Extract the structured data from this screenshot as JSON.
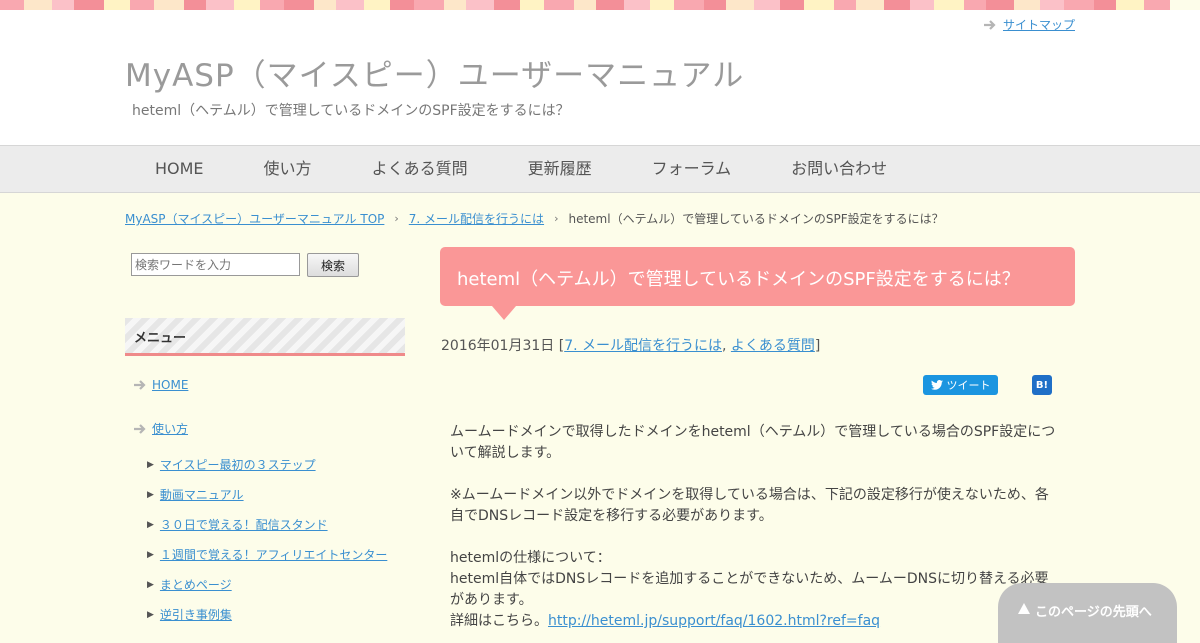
{
  "header": {
    "sitemap_label": "サイトマップ",
    "site_title": "MyASP（マイスピー）ユーザーマニュアル",
    "site_subtitle": "heteml（ヘテムル）で管理しているドメインのSPF設定をするには？"
  },
  "nav": [
    "HOME",
    "使い方",
    "よくある質問",
    "更新履歴",
    "フォーラム",
    "お問い合わせ"
  ],
  "breadcrumb": [
    "MyASP（マイスピー）ユーザーマニュアル TOP",
    "7. メール配信を行うには",
    "heteml（ヘテムル）で管理しているドメインのSPF設定をするには？"
  ],
  "search": {
    "placeholder": "検索ワードを入力",
    "button": "検索"
  },
  "sidebar": {
    "menu_heading": "メニュー",
    "items": [
      "HOME",
      "使い方"
    ],
    "sub_items": [
      "マイスピー最初の３ステップ",
      "動画マニュアル",
      "３０日で覚える！配信スタンド",
      "１週間で覚える！アフィリエイトセンター",
      "まとめページ",
      "逆引き事例集"
    ]
  },
  "post": {
    "title": "heteml（ヘテムル）で管理しているドメインのSPF設定をするには？",
    "date": "2016年01月31日",
    "cat1": "7. メール配信を行うには",
    "cat2": "よくある質問",
    "tweet_label": "ツイート",
    "hatena_label": "B!",
    "para1": "ムームードメインで取得したドメインをheteml（ヘテムル）で管理している場合のSPF設定について解説します。",
    "para2": "※ムームードメイン以外でドメインを取得している場合は、下記の設定移行が使えないため、各自でDNSレコード設定を移行する必要があります。",
    "para3_line1": "hetemlの仕様について：",
    "para3_line2": "heteml自体ではDNSレコードを追加することができないため、ムームーDNSに切り替える必要があります。",
    "para3_prefix": "詳細はこちら。",
    "para3_link": "http://heteml.jp/support/faq/1602.html?ref=faq"
  },
  "back_to_top": "このページの先頭へ",
  "colors": {
    "accent_pink": "#fa9797",
    "link_blue": "#3a8fd0",
    "bg_cream": "#fdfdea"
  }
}
